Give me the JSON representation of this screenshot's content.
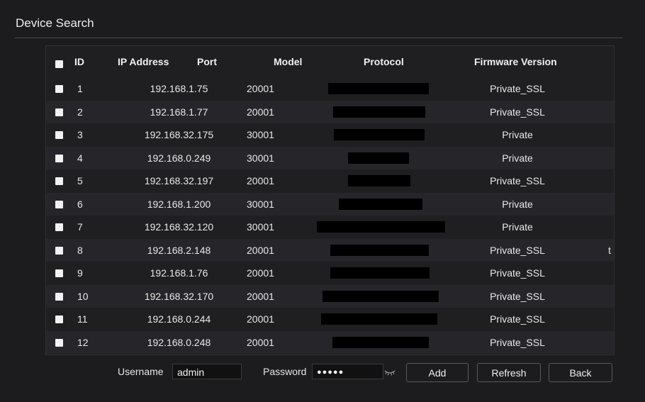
{
  "window": {
    "title": "Device Search"
  },
  "table": {
    "headers": {
      "id": "ID",
      "ip": "IP Address",
      "port": "Port",
      "model": "Model",
      "protocol": "Protocol",
      "firmware": "Firmware Version"
    },
    "rows": [
      {
        "id": "1",
        "ip": "192.168.1.75",
        "port": "20001",
        "protocol": "Private_SSL"
      },
      {
        "id": "2",
        "ip": "192.168.1.77",
        "port": "20001",
        "protocol": "Private_SSL"
      },
      {
        "id": "3",
        "ip": "192.168.32.175",
        "port": "30001",
        "protocol": "Private"
      },
      {
        "id": "4",
        "ip": "192.168.0.249",
        "port": "30001",
        "protocol": "Private"
      },
      {
        "id": "5",
        "ip": "192.168.32.197",
        "port": "20001",
        "protocol": "Private_SSL"
      },
      {
        "id": "6",
        "ip": "192.168.1.200",
        "port": "30001",
        "protocol": "Private"
      },
      {
        "id": "7",
        "ip": "192.168.32.120",
        "port": "30001",
        "protocol": "Private"
      },
      {
        "id": "8",
        "ip": "192.168.2.148",
        "port": "20001",
        "protocol": "Private_SSL",
        "extra": "t"
      },
      {
        "id": "9",
        "ip": "192.168.1.76",
        "port": "20001",
        "protocol": "Private_SSL"
      },
      {
        "id": "10",
        "ip": "192.168.32.170",
        "port": "20001",
        "protocol": "Private_SSL"
      },
      {
        "id": "11",
        "ip": "192.168.0.244",
        "port": "20001",
        "protocol": "Private_SSL"
      },
      {
        "id": "12",
        "ip": "192.168.0.248",
        "port": "20001",
        "protocol": "Private_SSL"
      }
    ]
  },
  "footer": {
    "username_label": "Username",
    "username_value": "admin",
    "password_label": "Password",
    "password_value": "●●●●●",
    "add_label": "Add",
    "refresh_label": "Refresh",
    "back_label": "Back"
  },
  "colors": {
    "background": "#1c1c1e",
    "row_alt": "#26262a",
    "redaction": "#000000"
  },
  "icons": {
    "password_toggle": "eye-closed-icon",
    "checkbox": "checkbox-icon"
  }
}
